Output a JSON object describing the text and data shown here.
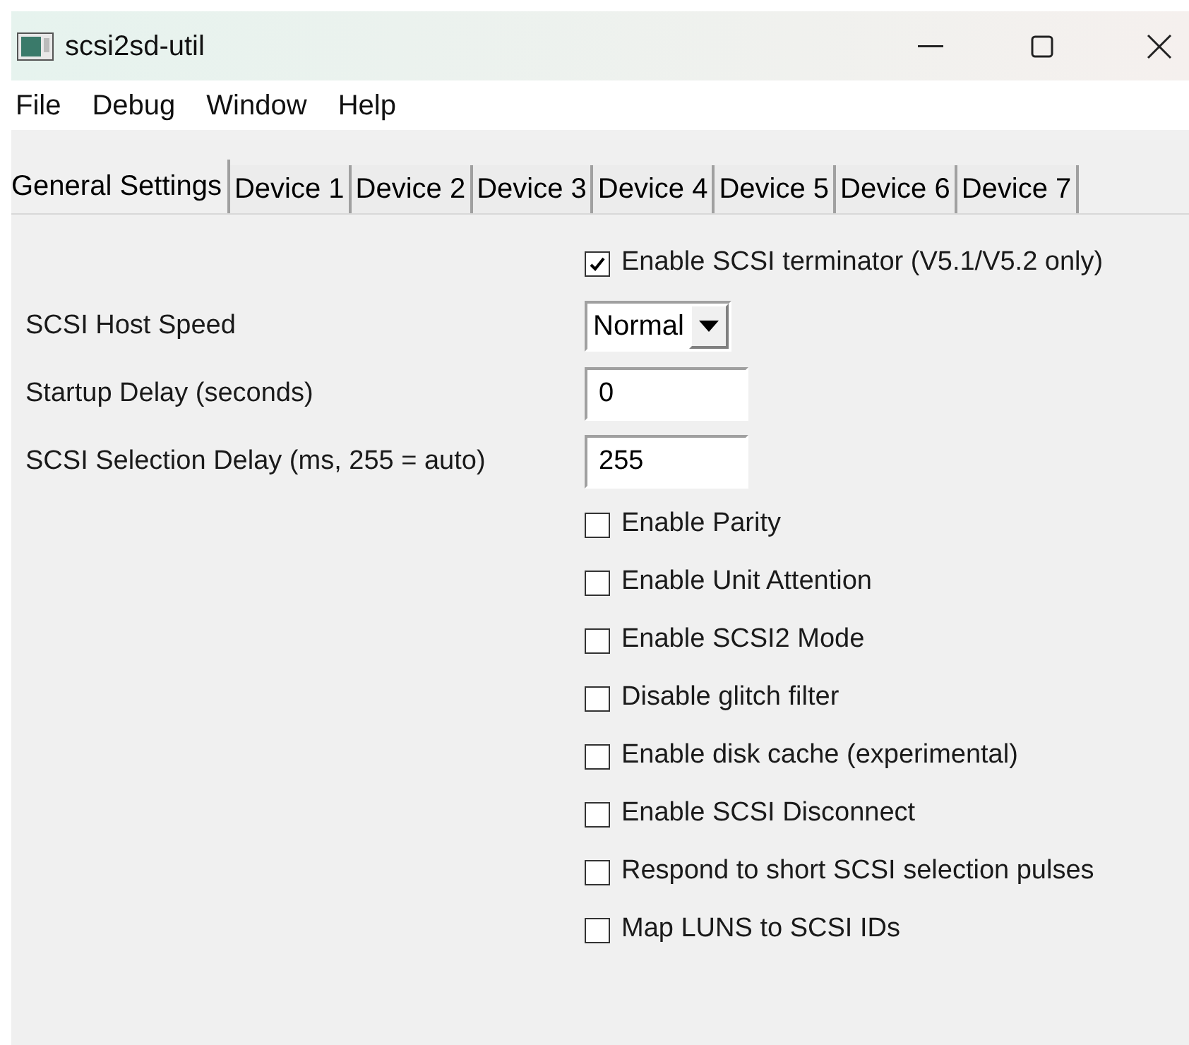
{
  "window": {
    "title": "scsi2sd-util"
  },
  "menu": [
    "File",
    "Debug",
    "Window",
    "Help"
  ],
  "tabs": [
    {
      "label": "General Settings",
      "selected": true
    },
    {
      "label": "Device 1",
      "selected": false
    },
    {
      "label": "Device 2",
      "selected": false
    },
    {
      "label": "Device 3",
      "selected": false
    },
    {
      "label": "Device 4",
      "selected": false
    },
    {
      "label": "Device 5",
      "selected": false
    },
    {
      "label": "Device 6",
      "selected": false
    },
    {
      "label": "Device 7",
      "selected": false
    }
  ],
  "settings": [
    {
      "kind": "checkbox",
      "text": "Enable SCSI terminator (V5.1/V5.2 only)",
      "checked": true
    },
    {
      "kind": "select",
      "label": "SCSI Host Speed",
      "value": "Normal"
    },
    {
      "kind": "text",
      "label": "Startup Delay (seconds)",
      "value": "0"
    },
    {
      "kind": "text",
      "label": "SCSI Selection Delay (ms, 255 = auto)",
      "value": "255"
    },
    {
      "kind": "checkbox",
      "text": "Enable Parity",
      "checked": false
    },
    {
      "kind": "checkbox",
      "text": "Enable Unit Attention",
      "checked": false
    },
    {
      "kind": "checkbox",
      "text": "Enable SCSI2 Mode",
      "checked": false
    },
    {
      "kind": "checkbox",
      "text": "Disable glitch filter",
      "checked": false
    },
    {
      "kind": "checkbox",
      "text": "Enable disk cache (experimental)",
      "checked": false
    },
    {
      "kind": "checkbox",
      "text": "Enable SCSI Disconnect",
      "checked": false
    },
    {
      "kind": "checkbox",
      "text": "Respond to short SCSI selection pulses",
      "checked": false
    },
    {
      "kind": "checkbox",
      "text": "Map LUNS to SCSI IDs",
      "checked": false
    }
  ]
}
